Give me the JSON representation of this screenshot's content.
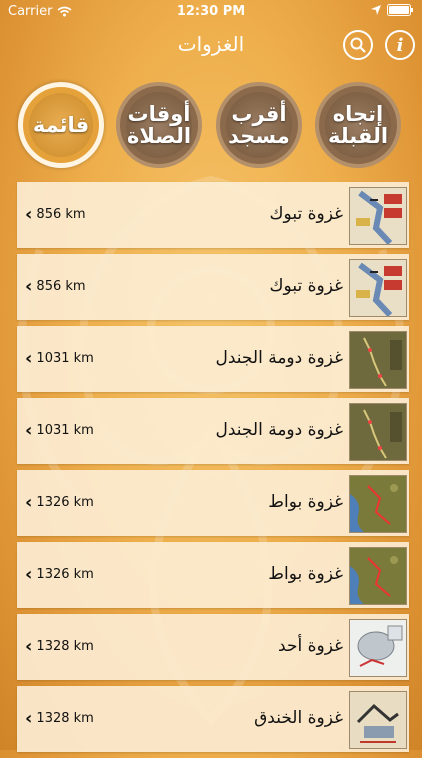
{
  "status": {
    "carrier": "Carrier",
    "time": "12:30 PM"
  },
  "header": {
    "title": "الغزوات",
    "info_label": "i"
  },
  "tabs": [
    {
      "label": "قائمة",
      "active": true
    },
    {
      "label": "أوقات\nالصلاة",
      "active": false
    },
    {
      "label": "أقرب\nمسجد",
      "active": false
    },
    {
      "label": "إتجاه\nالقبلة",
      "active": false
    }
  ],
  "list": [
    {
      "name": "غزوة تبوك",
      "distance": "856 km",
      "thumb": "map-red"
    },
    {
      "name": "غزوة تبوك",
      "distance": "856 km",
      "thumb": "map-red"
    },
    {
      "name": "غزوة دومة الجندل",
      "distance": "1031 km",
      "thumb": "map-green"
    },
    {
      "name": "غزوة دومة الجندل",
      "distance": "1031 km",
      "thumb": "map-green"
    },
    {
      "name": "غزوة بواط",
      "distance": "1326 km",
      "thumb": "map-coast"
    },
    {
      "name": "غزوة بواط",
      "distance": "1326 km",
      "thumb": "map-coast"
    },
    {
      "name": "غزوة أحد",
      "distance": "1328 km",
      "thumb": "map-uhud"
    },
    {
      "name": "غزوة الخندق",
      "distance": "1328 km",
      "thumb": "map-trench"
    }
  ]
}
